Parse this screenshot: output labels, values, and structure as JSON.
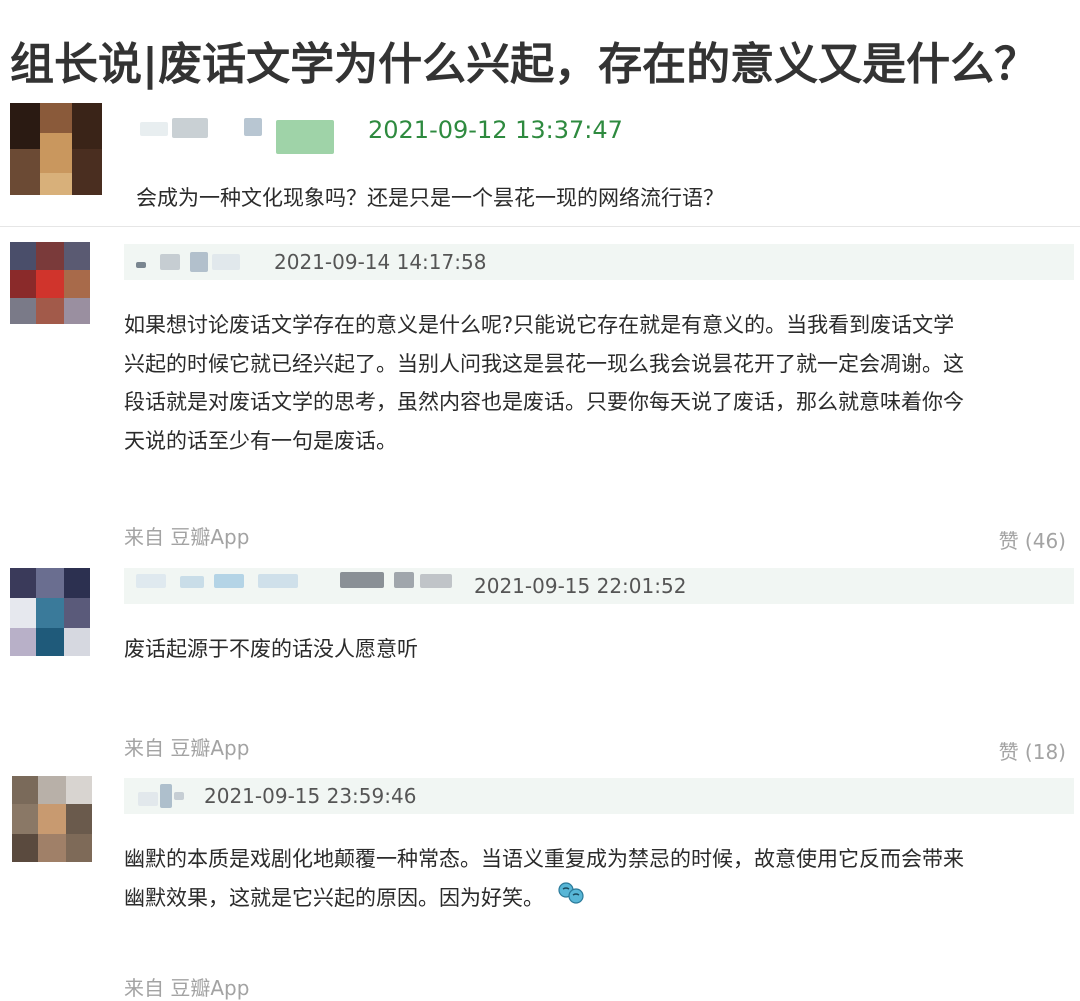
{
  "post": {
    "title": "组长说|废话文学为什么兴起，存在的意义又是什么？",
    "timestamp": "2021-09-12 13:37:47",
    "text": "会成为一种文化现象吗？还是只是一个昙花一现的网络流行语？"
  },
  "comments": [
    {
      "timestamp": "2021-09-14 14:17:58",
      "lines": [
        "如果想讨论废话文学存在的意义是什么呢?只能说它存在就是有意义的。当我看到废话文学",
        "兴起的时候它就已经兴起了。当别人问我这是昙花一现么我会说昙花开了就一定会凋谢。这",
        "段话就是对废话文学的思考，虽然内容也是废话。只要你每天说了废话，那么就意味着你今",
        "天说的话至少有一句是废话。"
      ],
      "source": "来自 豆瓣App",
      "likes": "赞 (46)"
    },
    {
      "timestamp": "2021-09-15 22:01:52",
      "lines": [
        "废话起源于不废的话没人愿意听"
      ],
      "source": "来自 豆瓣App",
      "likes": "赞 (18)"
    },
    {
      "timestamp": "2021-09-15 23:59:46",
      "lines": [
        "幽默的本质是戏剧化地颠覆一种常态。当语义重复成为禁忌的时候，故意使用它反而会带来",
        "幽默效果，这就是它兴起的原因。因为好笑。"
      ],
      "emoji": "laughing-tears-icon",
      "source": "来自 豆瓣App",
      "likes": ""
    }
  ],
  "colors": {
    "timestamp_green": "#2e8a3f",
    "comment_header_bg": "#f1f6f3",
    "meta_gray": "#a3a3a3"
  }
}
